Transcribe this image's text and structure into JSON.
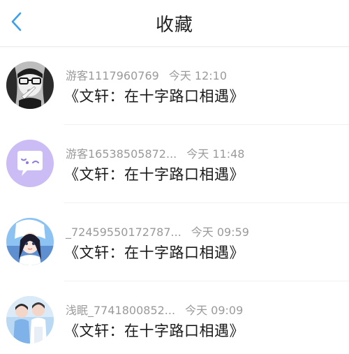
{
  "header": {
    "title": "收藏",
    "back_icon": "chevron-left-icon",
    "accent_color": "#3a9ff0"
  },
  "favorites": [
    {
      "username": "游客1117960769",
      "time": "今天 12:10",
      "content": "《文轩：在十字路口相遇》",
      "avatar": "photo-avatar-glasses"
    },
    {
      "username": "游客16538505872...",
      "time": "今天 11:48",
      "content": "《文轩：在十字路口相遇》",
      "avatar": "chat-bubble-avatar"
    },
    {
      "username": "_72459550172787...",
      "time": "今天 09:59",
      "content": "《文轩：在十字路口相遇》",
      "avatar": "photo-avatar-anime"
    },
    {
      "username": "浅眠_7741800852...",
      "time": "今天 09:09",
      "content": "《文轩：在十字路口相遇》",
      "avatar": "photo-avatar-couple"
    }
  ]
}
